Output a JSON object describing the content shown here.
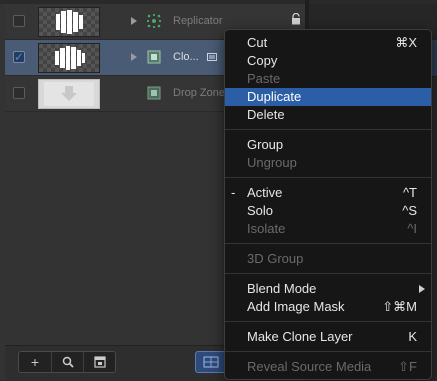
{
  "layers": [
    {
      "name": "Replicator",
      "checked": false,
      "selected": false,
      "dim": true,
      "type_icon": "replicator-icon",
      "locked": true
    },
    {
      "name": "Clo...",
      "checked": true,
      "selected": true,
      "dim": false,
      "type_icon": "clone-layer-icon",
      "locked": false
    },
    {
      "name": "Drop Zone",
      "checked": false,
      "selected": false,
      "dim": true,
      "type_icon": "drop-zone-icon",
      "locked": false
    }
  ],
  "bottom_bar": {
    "add_icon": "+",
    "search_icon": "search-icon",
    "frame_icon": "frame-icon"
  },
  "menu": {
    "cut": {
      "label": "Cut",
      "shortcut": "⌘X"
    },
    "copy": {
      "label": "Copy",
      "shortcut": ""
    },
    "paste": {
      "label": "Paste",
      "shortcut": ""
    },
    "duplicate": {
      "label": "Duplicate",
      "shortcut": ""
    },
    "delete": {
      "label": "Delete",
      "shortcut": ""
    },
    "group": {
      "label": "Group",
      "shortcut": ""
    },
    "ungroup": {
      "label": "Ungroup",
      "shortcut": ""
    },
    "active": {
      "label": "Active",
      "shortcut": "^T",
      "mark": "-"
    },
    "solo": {
      "label": "Solo",
      "shortcut": "^S"
    },
    "isolate": {
      "label": "Isolate",
      "shortcut": "^I"
    },
    "group3d": {
      "label": "3D Group",
      "shortcut": ""
    },
    "blend_mode": {
      "label": "Blend Mode",
      "shortcut": ""
    },
    "add_image_mask": {
      "label": "Add Image Mask",
      "shortcut": "⇧⌘M"
    },
    "make_clone": {
      "label": "Make Clone Layer",
      "shortcut": "K"
    },
    "reveal_source": {
      "label": "Reveal Source Media",
      "shortcut": "⇧F"
    }
  },
  "colors": {
    "highlight": "#2c5ea8",
    "selected_row": "#4a5b75"
  }
}
